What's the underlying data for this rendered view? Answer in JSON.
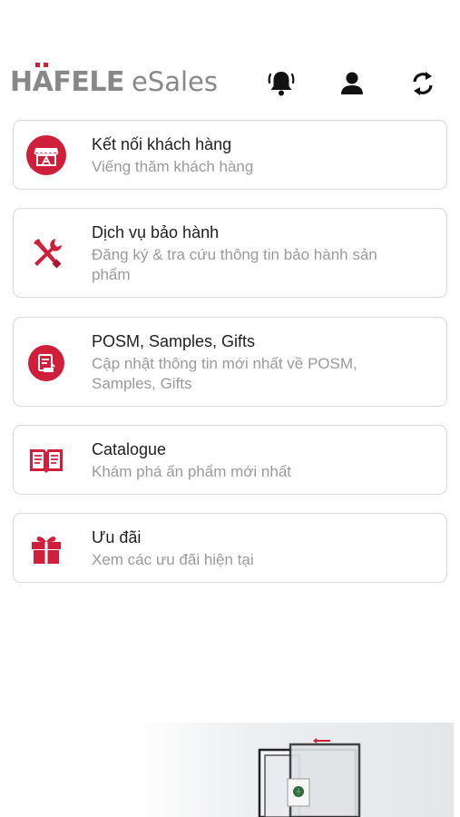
{
  "header": {
    "brand": "HAFELE",
    "brand_umlaut_letter": "A",
    "brand_rest": "FELE",
    "brand_first": "H",
    "product": "eSales",
    "icons": [
      "bell-icon",
      "user-icon",
      "sync-icon"
    ]
  },
  "colors": {
    "accent": "#cf1f3a",
    "logo_gray": "#888888",
    "border": "#d9d9d9",
    "subtitle": "#9a9a9a"
  },
  "menu": [
    {
      "title": "Kết nối khách hàng",
      "subtitle": "Viếng thăm khách hàng",
      "icon": "store-icon"
    },
    {
      "title": "Dịch vụ bảo hành",
      "subtitle": "Đăng ký & tra cứu thông tin bảo hành sản phẩm",
      "icon": "tools-icon"
    },
    {
      "title": "POSM, Samples, Gifts",
      "subtitle": "Cập nhật thông tin mới nhất về POSM, Samples, Gifts",
      "icon": "posm-icon"
    },
    {
      "title": "Catalogue",
      "subtitle": "Khám phá ấn phẩm mới nhất",
      "icon": "book-icon"
    },
    {
      "title": "Ưu đãi",
      "subtitle": "Xem các ưu đãi hiện tại",
      "icon": "gift-icon"
    }
  ]
}
